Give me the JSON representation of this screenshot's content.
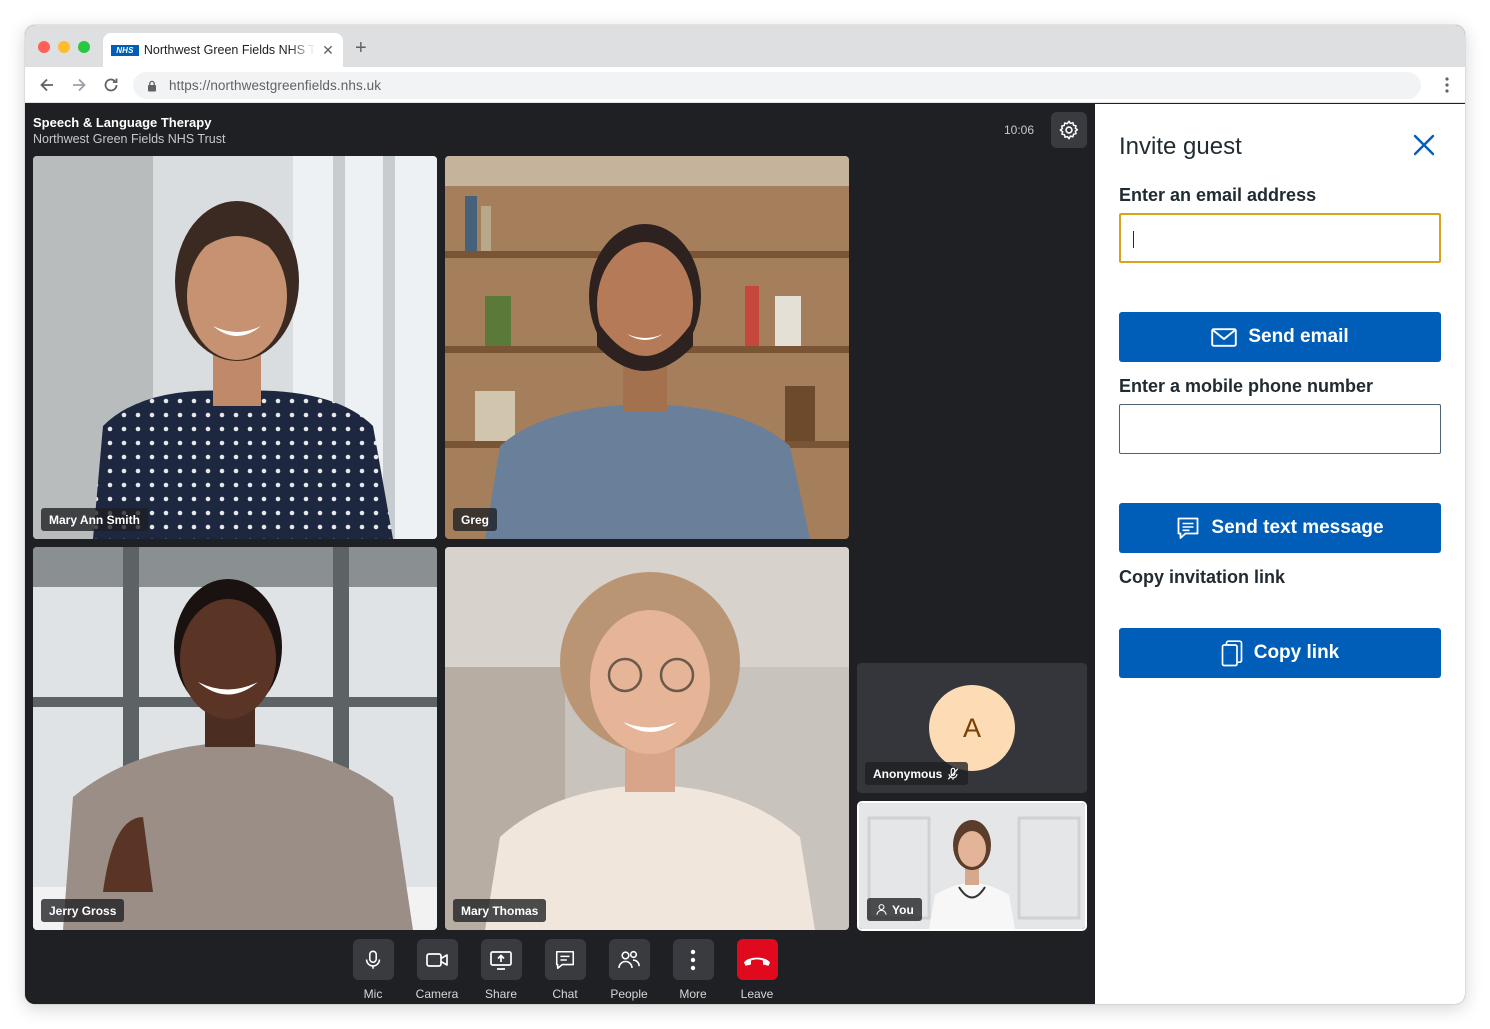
{
  "browser": {
    "tab_logo_text": "NHS",
    "tab_title": "Northwest Green Fields NHS Trust",
    "url": "https://northwestgreenfields.nhs.uk"
  },
  "call": {
    "title": "Speech & Language Therapy",
    "subtitle": "Northwest Green Fields NHS Trust",
    "time": "10:06",
    "participants": [
      {
        "name": "Mary Ann Smith"
      },
      {
        "name": "Greg"
      },
      {
        "name": "Jerry Gross"
      },
      {
        "name": "Mary Thomas"
      }
    ],
    "anonymous": {
      "initial": "A",
      "name": "Anonymous",
      "muted_icon": "mic-off-icon"
    },
    "self": {
      "name": "You"
    }
  },
  "controls": [
    {
      "label": "Mic",
      "icon": "mic-icon"
    },
    {
      "label": "Camera",
      "icon": "camera-icon"
    },
    {
      "label": "Share",
      "icon": "share-screen-icon"
    },
    {
      "label": "Chat",
      "icon": "chat-icon"
    },
    {
      "label": "People",
      "icon": "people-icon"
    },
    {
      "label": "More",
      "icon": "more-vertical-icon"
    },
    {
      "label": "Leave",
      "icon": "hang-up-icon"
    }
  ],
  "invite": {
    "title": "Invite guest",
    "email_label": "Enter an email address",
    "email_value": "",
    "send_email": "Send email",
    "phone_label": "Enter a mobile phone number",
    "phone_value": "",
    "send_text": "Send text message",
    "copy_label": "Copy invitation link",
    "copy_button": "Copy link"
  },
  "colors": {
    "nhs_blue": "#005eb8",
    "focus": "#d9a21f",
    "leave_red": "#e0091d",
    "call_bg": "#1f2023"
  }
}
